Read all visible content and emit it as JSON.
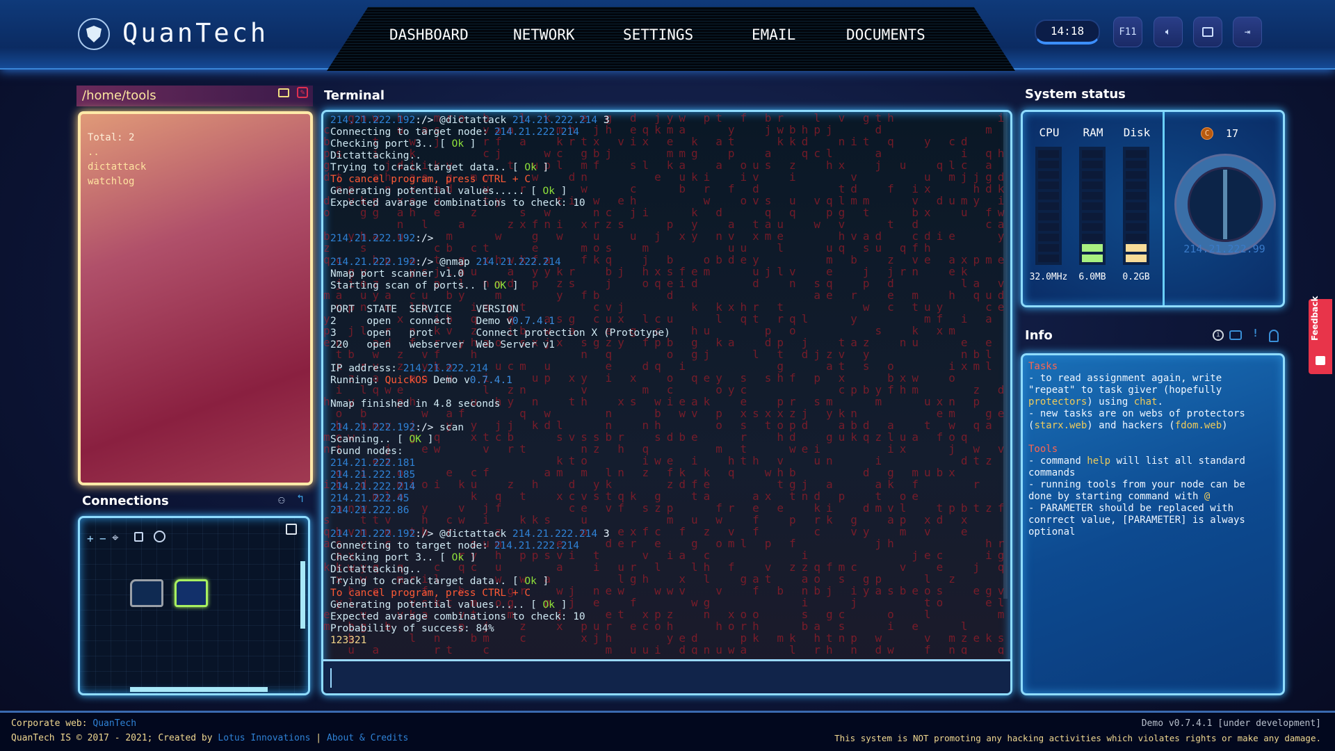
{
  "colors": {
    "accent": "#8fdcff",
    "ok": "#8fe23a",
    "warn": "#ff5a36",
    "ip": "#2f82d6",
    "feedback": "#e8344a"
  },
  "header": {
    "brand": "QuanTech",
    "logo_icon": "shield-icon",
    "nav": [
      "DASHBOARD",
      "NETWORK",
      "SETTINGS",
      "EMAIL",
      "DOCUMENTS"
    ],
    "time": "14:18",
    "buttons": [
      {
        "label": "F11",
        "icon": "fullscreen"
      },
      {
        "label": "",
        "icon": "volume-icon"
      },
      {
        "label": "",
        "icon": "window-icon"
      },
      {
        "label": "",
        "icon": "logout-icon"
      }
    ]
  },
  "files": {
    "title": "/home/tools",
    "total": "Total: 2",
    "items": [
      "..",
      "dictattack",
      "watchlog"
    ]
  },
  "connections": {
    "title": "Connections"
  },
  "terminal": {
    "title": "Terminal",
    "input_value": "",
    "lines": [
      [
        [
          "214.21.222.192",
          "ip"
        ],
        [
          ":/> ",
          "pm"
        ],
        [
          "@dictattack ",
          "t"
        ],
        [
          "214.21.222.214",
          "ip"
        ],
        [
          " 3",
          "pm"
        ]
      ],
      [
        [
          "Connecting to target node: ",
          "t"
        ],
        [
          "214.21.222.214",
          "ip"
        ]
      ],
      [
        [
          "Checking port 3.. [ ",
          "t"
        ],
        [
          "Ok",
          "ok"
        ],
        [
          " ]",
          "t"
        ]
      ],
      [
        [
          "Dictattacking..",
          "t"
        ]
      ],
      [
        [
          "Trying to crack target data.. [ ",
          "t"
        ],
        [
          "Ok",
          "ok"
        ],
        [
          " ]",
          "t"
        ]
      ],
      [
        [
          "To cancel program, press CTRL + C",
          "warn"
        ]
      ],
      [
        [
          "Generating potential values..... [ ",
          "t"
        ],
        [
          "Ok",
          "ok"
        ],
        [
          " ]",
          "t"
        ]
      ],
      [
        [
          "Expected avarage combinations to check: 10",
          "t"
        ]
      ],
      [],
      [],
      [
        [
          "214.21.222.192",
          "ip"
        ],
        [
          ":/>",
          "pm"
        ]
      ],
      [],
      [
        [
          "214.21.222.192",
          "ip"
        ],
        [
          ":/> ",
          "pm"
        ],
        [
          "@nmap ",
          "t"
        ],
        [
          "214.21.222.214",
          "ip"
        ]
      ],
      [
        [
          "Nmap port scanner v1.0",
          "t"
        ]
      ],
      [
        [
          "Starting scan of ports.. [ ",
          "t"
        ],
        [
          "OK",
          "ok"
        ],
        [
          " ]",
          "t"
        ]
      ],
      [],
      [
        [
          "PORT  STATE  SERVICE    VERSION",
          "t"
        ]
      ],
      [
        [
          "2     open   connect    Demo v",
          "t"
        ],
        [
          "0.7.4.1",
          "v"
        ]
      ],
      [
        [
          "3     open   prot       Connect protection X (Prototype)",
          "t"
        ]
      ],
      [
        [
          "220   open   webserver  Web Server v1",
          "t"
        ]
      ],
      [],
      [
        [
          "IP address: ",
          "t"
        ],
        [
          "214.21.222.214",
          "ip"
        ]
      ],
      [
        [
          "Running: ",
          "t"
        ],
        [
          "QuickOS",
          "warn"
        ],
        [
          " Demo v",
          "t"
        ],
        [
          "0.7.4.1",
          "v"
        ]
      ],
      [],
      [
        [
          "Nmap finished in 4.8 seconds",
          "t"
        ]
      ],
      [],
      [
        [
          "214.21.222.192",
          "ip"
        ],
        [
          ":/> ",
          "pm"
        ],
        [
          "scan",
          "t"
        ]
      ],
      [
        [
          "Scanning.. [ ",
          "t"
        ],
        [
          "OK",
          "ok"
        ],
        [
          " ]",
          "t"
        ]
      ],
      [
        [
          "Found nodes:",
          "t"
        ]
      ],
      [
        [
          "214.21.222.181",
          "ip"
        ]
      ],
      [
        [
          "214.21.222.185",
          "ip"
        ]
      ],
      [
        [
          "214.21.222.214",
          "ip"
        ]
      ],
      [
        [
          "214.21.222.45",
          "ip"
        ]
      ],
      [
        [
          "214.21.222.86",
          "ip"
        ]
      ],
      [],
      [
        [
          "214.21.222.192",
          "ip"
        ],
        [
          ":/> ",
          "pm"
        ],
        [
          "@dictattack ",
          "t"
        ],
        [
          "214.21.222.214",
          "ip"
        ],
        [
          " 3",
          "pm"
        ]
      ],
      [
        [
          "Connecting to target node: ",
          "t"
        ],
        [
          "214.21.222.214",
          "ip"
        ]
      ],
      [
        [
          "Checking port 3.. [ ",
          "t"
        ],
        [
          "Ok",
          "ok"
        ],
        [
          " ]",
          "t"
        ]
      ],
      [
        [
          "Dictattacking..",
          "t"
        ]
      ],
      [
        [
          "Trying to crack target data.. [ ",
          "t"
        ],
        [
          "Ok",
          "ok"
        ],
        [
          " ]",
          "t"
        ]
      ],
      [
        [
          "To cancel program, press CTRL + C",
          "warn"
        ]
      ],
      [
        [
          "Generating potential values..... [ ",
          "t"
        ],
        [
          "Ok",
          "ok"
        ],
        [
          " ]",
          "t"
        ]
      ],
      [
        [
          "Expected avarage combinations to check: 10",
          "t"
        ]
      ],
      [
        [
          "Probability of success: 84%",
          "t"
        ]
      ],
      [
        [
          "123321",
          "num"
        ]
      ]
    ]
  },
  "system": {
    "title": "System status",
    "meters": [
      {
        "label": "CPU",
        "value": "32.0MHz",
        "lit": 0,
        "color": "#a8f080"
      },
      {
        "label": "RAM",
        "value": "6.0MB",
        "lit": 2,
        "color": "#a8f080"
      },
      {
        "label": "Disk",
        "value": "0.2GB",
        "lit": 2,
        "color": "#f8dc98"
      }
    ],
    "segments": 11,
    "credits": "17",
    "credit_icon": "C",
    "ip": "214.21.222.99"
  },
  "info": {
    "title": "Info",
    "lines": [
      [
        [
          "Tasks",
          "h"
        ]
      ],
      [
        [
          "- to read assignment again, write",
          "w"
        ]
      ],
      [
        [
          "\"repeat\" to task giver (hopefully",
          "w"
        ]
      ],
      [
        [
          "protectors",
          "y"
        ],
        [
          ") using ",
          "w"
        ],
        [
          "chat",
          "y"
        ],
        [
          ".",
          "w"
        ]
      ],
      [
        [
          "- new tasks are on webs of protectors",
          "w"
        ]
      ],
      [
        [
          "(",
          "w"
        ],
        [
          "starx.web",
          "y"
        ],
        [
          ") and hackers (",
          "w"
        ],
        [
          "fdom.web",
          "y"
        ],
        [
          ")",
          "w"
        ]
      ],
      [],
      [
        [
          "Tools",
          "h"
        ]
      ],
      [
        [
          "- command ",
          "w"
        ],
        [
          "help",
          "y"
        ],
        [
          " will list all standard",
          "w"
        ]
      ],
      [
        [
          "commands",
          "w"
        ]
      ],
      [
        [
          "- running tools from your node can be",
          "w"
        ]
      ],
      [
        [
          "done by starting command with ",
          "w"
        ],
        [
          "@",
          "y"
        ]
      ],
      [
        [
          "- PARAMETER should be replaced with",
          "w"
        ]
      ],
      [
        [
          "conrrect value, [PARAMETER] is always",
          "w"
        ]
      ],
      [
        [
          "optional",
          "w"
        ]
      ]
    ]
  },
  "feedback": {
    "label": "Feedback"
  },
  "footer": {
    "corp_label": "Corporate web: ",
    "corp_link": "QuanTech",
    "copyright": "QuanTech IS © 2017 - 2021; Created by ",
    "creator": "Lotus Innovations",
    "sep": " | ",
    "about": "About & Credits",
    "version": "Demo v0.7.4.1 [under development]",
    "disclaimer": "This system is NOT promoting any hacking activities which violates rights or make any damage."
  }
}
